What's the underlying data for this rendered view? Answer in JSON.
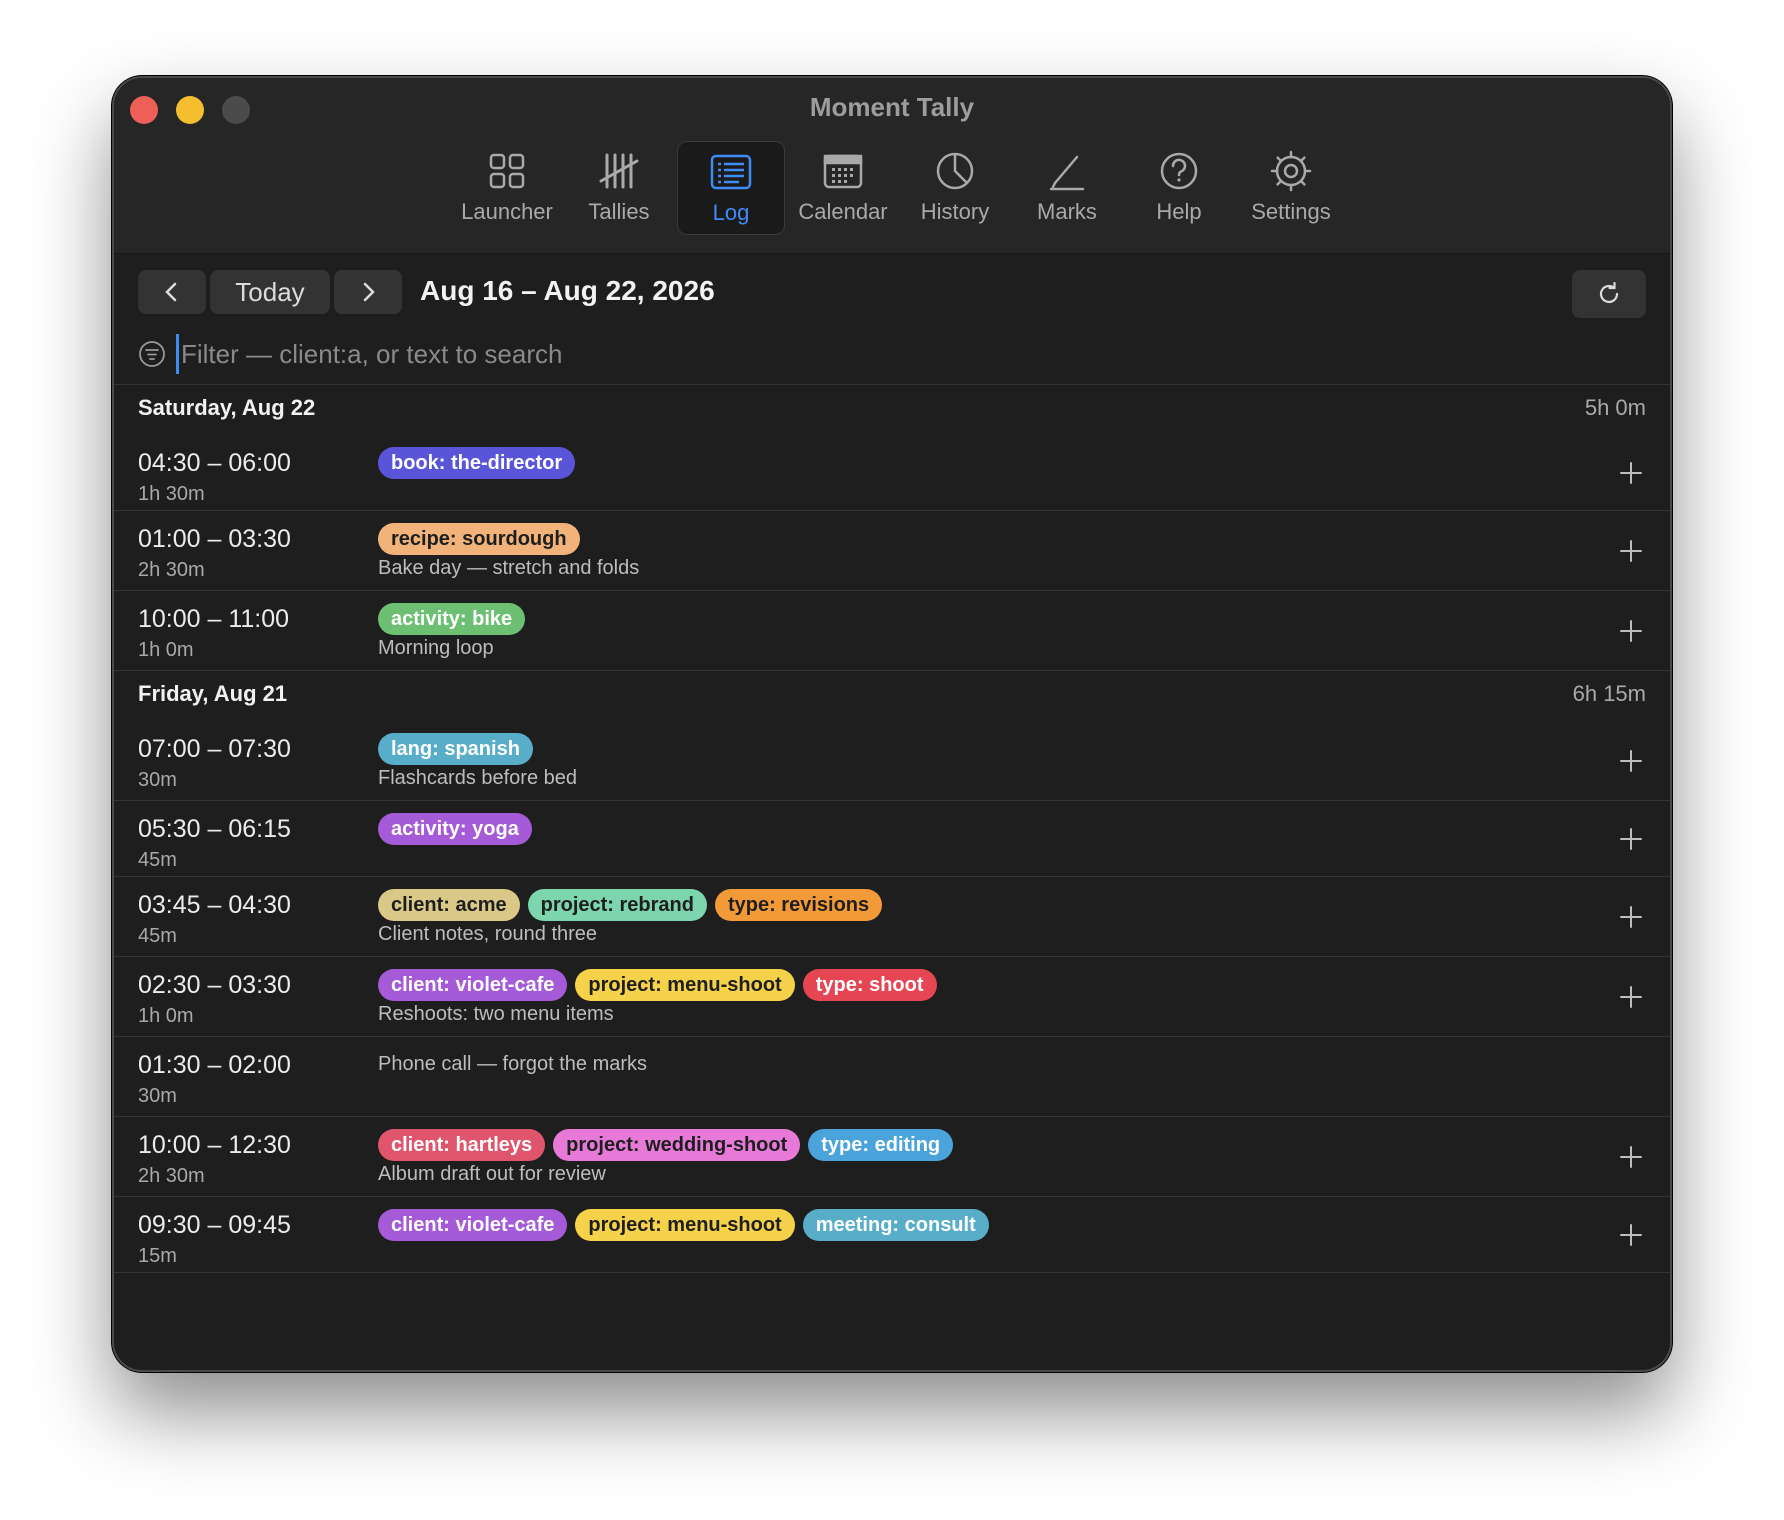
{
  "window": {
    "title": "Moment Tally"
  },
  "toolbar": {
    "items": [
      {
        "label": "Launcher",
        "icon": "grid-icon"
      },
      {
        "label": "Tallies",
        "icon": "tally-marks-icon"
      },
      {
        "label": "Log",
        "icon": "list-icon",
        "active": true
      },
      {
        "label": "Calendar",
        "icon": "calendar-icon"
      },
      {
        "label": "History",
        "icon": "pie-chart-icon"
      },
      {
        "label": "Marks",
        "icon": "pencil-icon"
      },
      {
        "label": "Help",
        "icon": "question-icon"
      },
      {
        "label": "Settings",
        "icon": "gear-icon"
      }
    ]
  },
  "nav": {
    "today_label": "Today",
    "date_range": "Aug 16 – Aug 22, 2026"
  },
  "filter": {
    "placeholder": "Filter — client:a, or text to search",
    "value": ""
  },
  "colors": {
    "accent": "#3f8bf6",
    "window_bg": "#1e1e1e"
  },
  "days": [
    {
      "title": "Saturday, Aug 22",
      "total": "5h 0m",
      "entries": [
        {
          "time": "04:30 – 06:00",
          "duration": "1h 30m",
          "tags": [
            {
              "text": "book: the-director",
              "bg": "#5a55d8",
              "fg": "#ffffff"
            }
          ],
          "note": ""
        },
        {
          "time": "01:00 – 03:30",
          "duration": "2h 30m",
          "tags": [
            {
              "text": "recipe: sourdough",
              "bg": "#f1b37a",
              "fg": "#1e1e1e"
            }
          ],
          "note": "Bake day — stretch and folds"
        },
        {
          "time": "10:00 – 11:00",
          "duration": "1h 0m",
          "tags": [
            {
              "text": "activity: bike",
              "bg": "#6cbf73",
              "fg": "#ffffff"
            }
          ],
          "note": "Morning loop"
        }
      ]
    },
    {
      "title": "Friday, Aug 21",
      "total": "6h 15m",
      "entries": [
        {
          "time": "07:00 – 07:30",
          "duration": "30m",
          "tags": [
            {
              "text": "lang: spanish",
              "bg": "#58aec9",
              "fg": "#ffffff"
            }
          ],
          "note": "Flashcards before bed"
        },
        {
          "time": "05:30 – 06:15",
          "duration": "45m",
          "tags": [
            {
              "text": "activity: yoga",
              "bg": "#a55ad8",
              "fg": "#ffffff"
            }
          ],
          "note": ""
        },
        {
          "time": "03:45 – 04:30",
          "duration": "45m",
          "tags": [
            {
              "text": "client: acme",
              "bg": "#d9c887",
              "fg": "#1e1e1e"
            },
            {
              "text": "project: rebrand",
              "bg": "#7cd5ac",
              "fg": "#1e1e1e"
            },
            {
              "text": "type: revisions",
              "bg": "#f39a38",
              "fg": "#1e1e1e"
            }
          ],
          "note": "Client notes, round three"
        },
        {
          "time": "02:30 – 03:30",
          "duration": "1h 0m",
          "tags": [
            {
              "text": "client: violet-cafe",
              "bg": "#a55ad8",
              "fg": "#ffffff"
            },
            {
              "text": "project: menu-shoot",
              "bg": "#f5d24a",
              "fg": "#1e1e1e"
            },
            {
              "text": "type: shoot",
              "bg": "#e64553",
              "fg": "#ffffff"
            }
          ],
          "note": "Reshoots: two menu items"
        },
        {
          "time": "01:30 – 02:00",
          "duration": "30m",
          "tags": [],
          "note": "Phone call — forgot the marks"
        },
        {
          "time": "10:00 – 12:30",
          "duration": "2h 30m",
          "tags": [
            {
              "text": "client: hartleys",
              "bg": "#e0556b",
              "fg": "#ffffff"
            },
            {
              "text": "project: wedding-shoot",
              "bg": "#e77ad8",
              "fg": "#1e1e1e"
            },
            {
              "text": "type: editing",
              "bg": "#4aa3db",
              "fg": "#ffffff"
            }
          ],
          "note": "Album draft out for review"
        },
        {
          "time": "09:30 – 09:45",
          "duration": "15m",
          "tags": [
            {
              "text": "client: violet-cafe",
              "bg": "#a55ad8",
              "fg": "#ffffff"
            },
            {
              "text": "project: menu-shoot",
              "bg": "#f5d24a",
              "fg": "#1e1e1e"
            },
            {
              "text": "meeting: consult",
              "bg": "#58aec9",
              "fg": "#ffffff"
            }
          ],
          "note": ""
        }
      ]
    }
  ]
}
